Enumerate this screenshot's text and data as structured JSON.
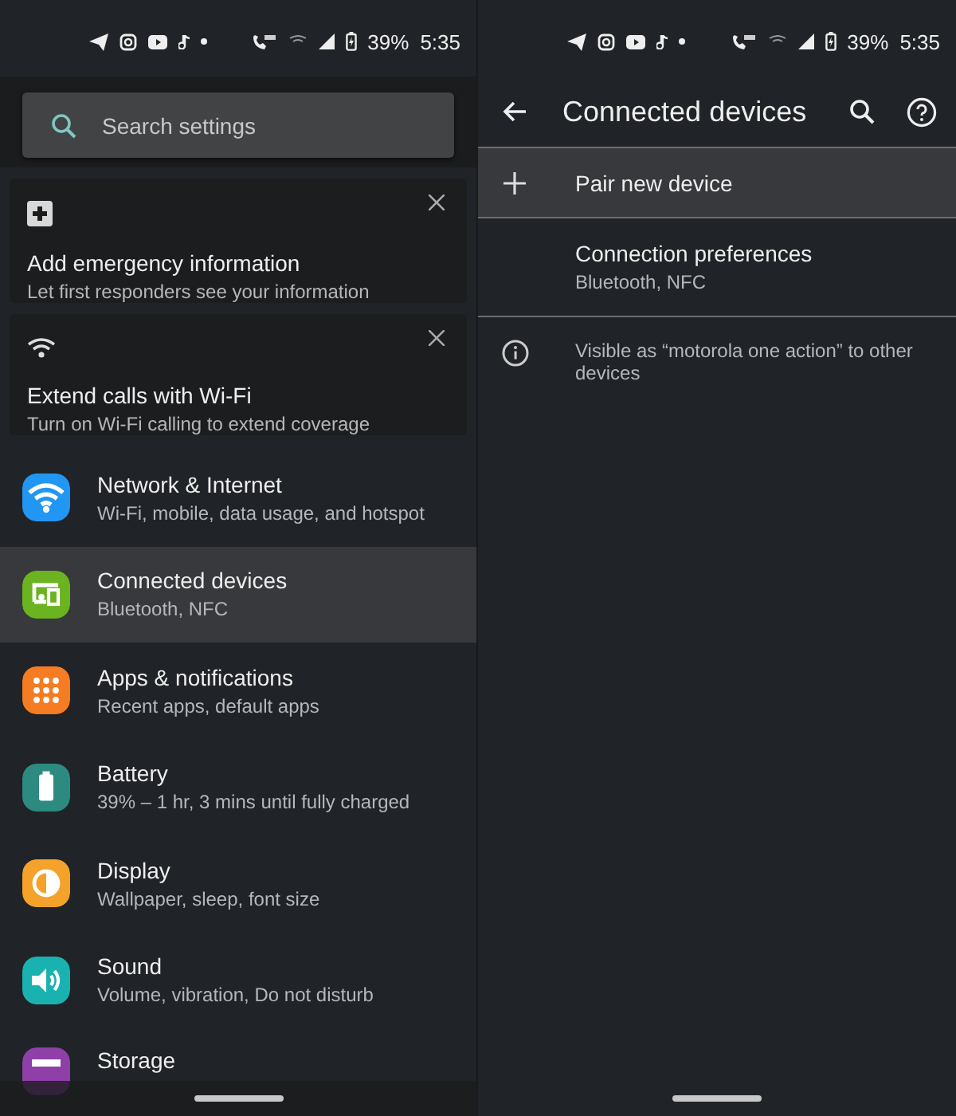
{
  "left_pane": {
    "status_bar": {
      "battery": "39%",
      "time": "5:35"
    },
    "search": {
      "placeholder": "Search settings"
    },
    "suggestion_cards": [
      {
        "kind": "emergency",
        "title": "Add emergency information",
        "subtitle": "Let first responders see your information"
      },
      {
        "kind": "wifi",
        "title": "Extend calls with Wi-Fi",
        "subtitle": "Turn on Wi-Fi calling to extend coverage"
      }
    ],
    "settings": [
      {
        "kind": "network",
        "color": "#2196f3",
        "title": "Network & Internet",
        "subtitle": "Wi-Fi, mobile, data usage, and hotspot",
        "selected": false
      },
      {
        "kind": "devices",
        "color": "#6bb31f",
        "title": "Connected devices",
        "subtitle": "Bluetooth, NFC",
        "selected": true
      },
      {
        "kind": "apps",
        "color": "#f57c22",
        "title": "Apps & notifications",
        "subtitle": "Recent apps, default apps",
        "selected": false
      },
      {
        "kind": "battery",
        "color": "#2d8a80",
        "title": "Battery",
        "subtitle": "39% – 1 hr, 3 mins until fully charged",
        "selected": false
      },
      {
        "kind": "display",
        "color": "#f5a22a",
        "title": "Display",
        "subtitle": "Wallpaper, sleep, font size",
        "selected": false
      },
      {
        "kind": "sound",
        "color": "#1ab2b0",
        "title": "Sound",
        "subtitle": "Volume, vibration, Do not disturb",
        "selected": false
      },
      {
        "kind": "storage",
        "color": "#8e3fa8",
        "title": "Storage",
        "selected": false
      }
    ]
  },
  "right_pane": {
    "status_bar": {
      "battery": "39%",
      "time": "5:35"
    },
    "toolbar": {
      "title": "Connected devices"
    },
    "items": [
      {
        "kind": "add",
        "title": "Pair new device",
        "selected": true
      },
      {
        "kind": "plain",
        "title": "Connection preferences",
        "subtitle": "Bluetooth, NFC",
        "selected": false
      }
    ],
    "footer": {
      "text": "Visible as “motorola one action” to other devices"
    }
  }
}
